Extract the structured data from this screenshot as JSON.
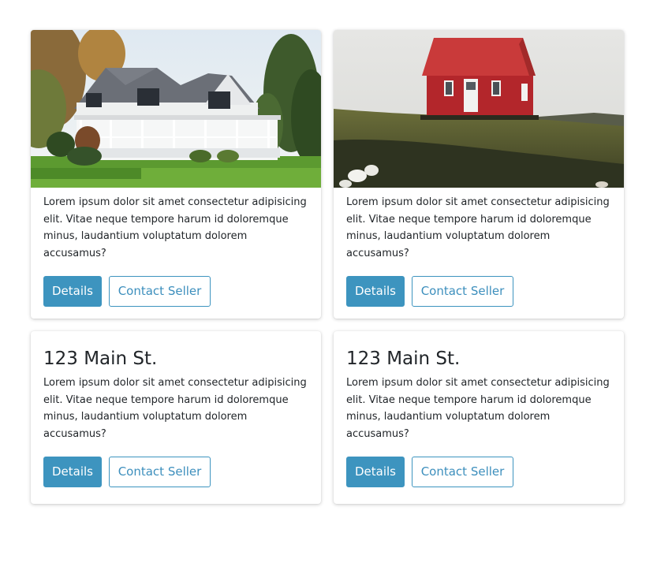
{
  "cards": [
    {
      "image": "white-house-photo",
      "text": "Lorem ipsum dolor sit amet consectetur adipisicing elit. Vitae neque tempore harum id doloremque minus, laudantium voluptatum dolorem accusamus?",
      "details_label": "Details",
      "contact_label": "Contact Seller"
    },
    {
      "image": "red-cabin-photo",
      "text": "Lorem ipsum dolor sit amet consectetur adipisicing elit. Vitae neque tempore harum id doloremque minus, laudantium voluptatum dolorem accusamus?",
      "details_label": "Details",
      "contact_label": "Contact Seller"
    },
    {
      "title": "123 Main St.",
      "text": "Lorem ipsum dolor sit amet consectetur adipisicing elit. Vitae neque tempore harum id doloremque minus, laudantium voluptatum dolorem accusamus?",
      "details_label": "Details",
      "contact_label": "Contact Seller"
    },
    {
      "title": "123 Main St.",
      "text": "Lorem ipsum dolor sit amet consectetur adipisicing elit. Vitae neque tempore harum id doloremque minus, laudantium voluptatum dolorem accusamus?",
      "details_label": "Details",
      "contact_label": "Contact Seller"
    }
  ],
  "colors": {
    "accent": "#3d94bf",
    "text": "#212529",
    "background": "#ffffff"
  }
}
